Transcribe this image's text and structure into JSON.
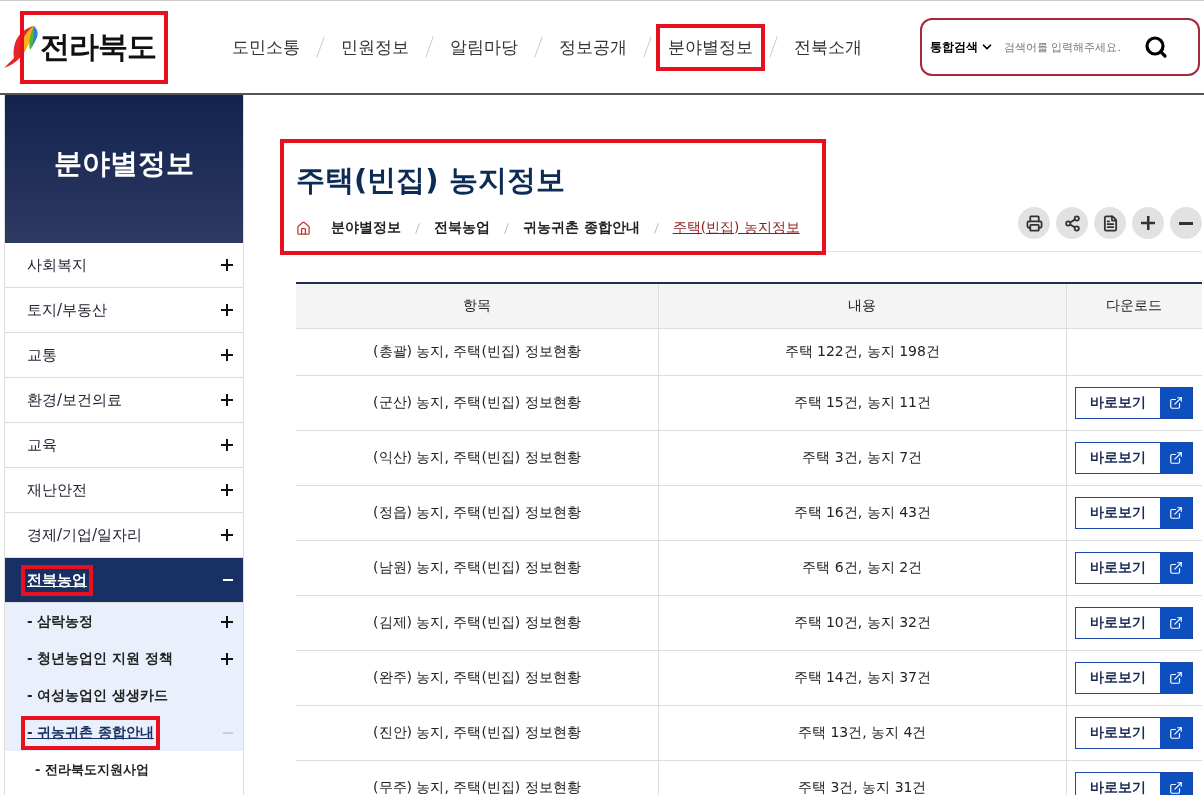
{
  "logo": {
    "text": "전라북도",
    "highlighted": true
  },
  "nav": [
    {
      "label": "도민소통",
      "highlighted": false
    },
    {
      "label": "민원정보",
      "highlighted": false
    },
    {
      "label": "알림마당",
      "highlighted": false
    },
    {
      "label": "정보공개",
      "highlighted": false
    },
    {
      "label": "분야별정보",
      "highlighted": true
    },
    {
      "label": "전북소개",
      "highlighted": false
    }
  ],
  "search": {
    "scope": "통합검색",
    "placeholder": "검색어를 입력해주세요."
  },
  "sidebar": {
    "title": "분야별정보",
    "items": [
      {
        "label": "사회복지",
        "expanded": false,
        "selected": false,
        "highlighted": false
      },
      {
        "label": "토지/부동산",
        "expanded": false,
        "selected": false,
        "highlighted": false
      },
      {
        "label": "교통",
        "expanded": false,
        "selected": false,
        "highlighted": false
      },
      {
        "label": "환경/보건의료",
        "expanded": false,
        "selected": false,
        "highlighted": false
      },
      {
        "label": "교육",
        "expanded": false,
        "selected": false,
        "highlighted": false
      },
      {
        "label": "재난안전",
        "expanded": false,
        "selected": false,
        "highlighted": false
      },
      {
        "label": "경제/기업/일자리",
        "expanded": false,
        "selected": false,
        "highlighted": false
      },
      {
        "label": "전북농업",
        "expanded": true,
        "selected": true,
        "highlighted": true,
        "children": [
          {
            "label": "- 삼락농정",
            "has_children": true,
            "expanded": false,
            "selected": false,
            "highlighted": false
          },
          {
            "label": "- 청년농업인 지원 정책",
            "has_children": true,
            "expanded": false,
            "selected": false,
            "highlighted": false
          },
          {
            "label": "- 여성농업인 생생카드",
            "has_children": false,
            "selected": false,
            "highlighted": false
          },
          {
            "label": "- 귀농귀촌 종합안내",
            "has_children": true,
            "expanded": true,
            "selected": true,
            "highlighted": true,
            "children": [
              {
                "label": "- 전라북도지원사업"
              }
            ]
          }
        ]
      }
    ]
  },
  "page": {
    "title": "주택(빈집) 농지정보",
    "highlighted": true,
    "breadcrumb": [
      {
        "label": "분야별정보",
        "selected": false
      },
      {
        "label": "전북농업",
        "selected": false
      },
      {
        "label": "귀농귀촌 종합안내",
        "selected": false
      },
      {
        "label": "주택(빈집) 농지정보",
        "selected": true
      }
    ]
  },
  "table": {
    "columns": [
      "항목",
      "내용",
      "다운로드"
    ],
    "rows": [
      {
        "item": "(총괄) 농지, 주택(빈집) 정보현황",
        "content": "주택 122건, 농지 198건"
      },
      {
        "item": "(군산) 농지, 주택(빈집) 정보현황",
        "content": "주택 15건, 농지 11건",
        "download": "바로보기"
      },
      {
        "item": "(익산) 농지, 주택(빈집) 정보현황",
        "content": "주택 3건, 농지 7건",
        "download": "바로보기"
      },
      {
        "item": "(정읍) 농지, 주택(빈집) 정보현황",
        "content": "주택 16건, 농지 43건",
        "download": "바로보기"
      },
      {
        "item": "(남원) 농지, 주택(빈집) 정보현황",
        "content": "주택 6건, 농지 2건",
        "download": "바로보기"
      },
      {
        "item": "(김제) 농지, 주택(빈집) 정보현황",
        "content": "주택 10건, 농지 32건",
        "download": "바로보기"
      },
      {
        "item": "(완주) 농지, 주택(빈집) 정보현황",
        "content": "주택 14건, 농지 37건",
        "download": "바로보기"
      },
      {
        "item": "(진안) 농지, 주택(빈집) 정보현황",
        "content": "주택 13건, 농지 4건",
        "download": "바로보기"
      },
      {
        "item": "(무주) 농지, 주택(빈집) 정보현황",
        "content": "주택 3건, 농지 31건",
        "download": "바로보기"
      }
    ]
  }
}
